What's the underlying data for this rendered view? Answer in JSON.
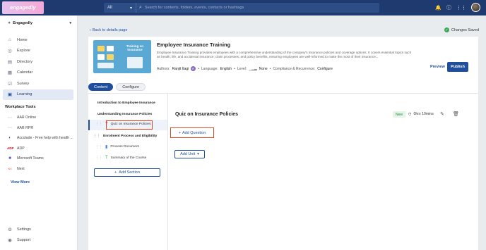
{
  "topbar": {
    "logo": "engagedly",
    "search_scope": "All",
    "search_placeholder": "Search for contents, folders, events, contacts or hashtags"
  },
  "sidebar": {
    "org_name": "Engagedly",
    "items": [
      {
        "label": "Home",
        "icon": "home-icon"
      },
      {
        "label": "Explore",
        "icon": "explore-icon"
      },
      {
        "label": "Directory",
        "icon": "directory-icon"
      },
      {
        "label": "Calendar",
        "icon": "calendar-icon"
      },
      {
        "label": "Survey",
        "icon": "survey-icon"
      },
      {
        "label": "Learning",
        "icon": "learning-icon",
        "active": true
      }
    ],
    "tools_title": "Workplace Tools",
    "tools": [
      {
        "label": "AAR Online",
        "icon": "aar-icon"
      },
      {
        "label": "AAR RPR",
        "icon": "aar-icon"
      },
      {
        "label": "Accolade - Free help with health ...",
        "icon": "accolade-icon"
      },
      {
        "label": "ADP",
        "icon": "adp-icon"
      },
      {
        "label": "Microsoft Teams",
        "icon": "teams-icon"
      },
      {
        "label": "Next",
        "icon": "next-icon"
      }
    ],
    "view_more": "View More",
    "bottom": [
      {
        "label": "Settings",
        "icon": "settings-icon"
      },
      {
        "label": "Support",
        "icon": "support-icon"
      }
    ]
  },
  "page": {
    "back_label": "Back to details page",
    "saved_label": "Changes Saved"
  },
  "course": {
    "thumb_title": "Training on Insurance",
    "title": "Employee Insurance Training",
    "description": "Employee Insurance Training provides employees with a comprehensive understanding of the company's insurance policies and coverage options. It covers essential topics such as health, life, and accidental insurance; claim processes; and policy benefits, ensuring employees are well-informed to make the most of their insurance...",
    "authors_label": "Authors:",
    "author": "Ranjit Itagi",
    "author_initial": "R",
    "language_label": "Language:",
    "language": "English",
    "level_label": "Level:",
    "level": "None",
    "compliance_label": "Compliance & Recurrence:",
    "compliance": "Configure",
    "preview": "Preview",
    "publish": "Publish"
  },
  "tabs": [
    "Content",
    "Configure"
  ],
  "outline": {
    "items": [
      {
        "label": "Introduction to Employee Insurance",
        "type": "section"
      },
      {
        "label": "Understanding Insurance Policies",
        "type": "section"
      },
      {
        "label": "Quiz on Insurance Policies",
        "type": "quiz"
      },
      {
        "label": "Enrolment Process and Eligibility",
        "type": "section"
      },
      {
        "label": "Process Document",
        "type": "document"
      },
      {
        "label": "Summary of the Course",
        "type": "summary"
      }
    ],
    "add_section": "Add Section"
  },
  "editor": {
    "title": "Quiz on Insurance Policies",
    "badge": "New",
    "duration": "0hrs 10mins",
    "add_question": "Add Question",
    "add_unit": "Add Unit"
  }
}
